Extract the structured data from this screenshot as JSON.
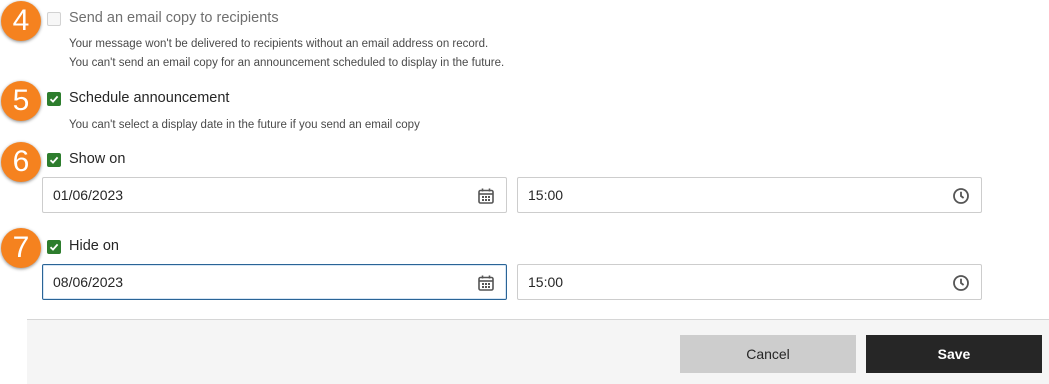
{
  "steps": [
    "4",
    "5",
    "6",
    "7"
  ],
  "email_copy": {
    "label": "Send an email copy to recipients",
    "checked": false,
    "help_1": "Your message won't be delivered to recipients without an email address on record.",
    "help_2": "You can't send an email copy for an announcement scheduled to display in the future."
  },
  "schedule": {
    "label": "Schedule announcement",
    "checked": true,
    "help": "You can't select a display date in the future if you send an email copy"
  },
  "show_on": {
    "label": "Show on",
    "checked": true,
    "date": "01/06/2023",
    "time": "15:00"
  },
  "hide_on": {
    "label": "Hide on",
    "checked": true,
    "date": "08/06/2023",
    "time": "15:00"
  },
  "footer": {
    "cancel_label": "Cancel",
    "save_label": "Save"
  },
  "icons": {
    "date": "calendar-icon",
    "time": "clock-icon",
    "check": "checkmark-icon"
  },
  "colors": {
    "badge": "#f5821f",
    "checkbox_checked": "#2d7d2d",
    "save_button": "#262626",
    "cancel_button": "#cdcdcd",
    "focus_border": "#2a6496"
  }
}
